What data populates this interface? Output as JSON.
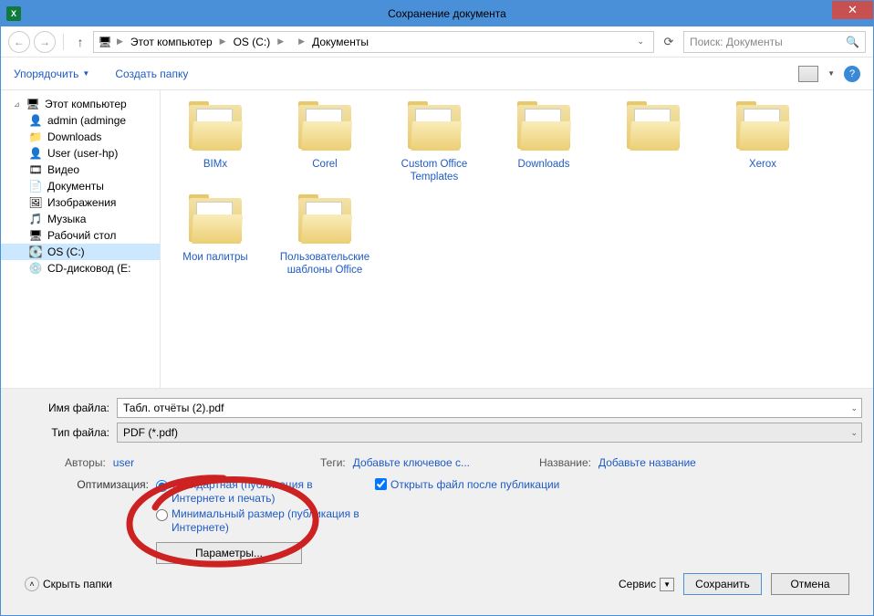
{
  "title": "Сохранение документа",
  "nav": {
    "breadcrumb": [
      "Этот компьютер",
      "OS (C:)",
      "",
      "Документы"
    ],
    "search_placeholder": "Поиск: Документы"
  },
  "toolbar": {
    "organize": "Упорядочить",
    "new_folder": "Создать папку"
  },
  "tree": {
    "root": "Этот компьютер",
    "items": [
      {
        "label": "admin (adminge",
        "icon": "👤"
      },
      {
        "label": "Downloads",
        "icon": "📁"
      },
      {
        "label": "User (user-hp)",
        "icon": "👤"
      },
      {
        "label": "Видео",
        "icon": "🎞"
      },
      {
        "label": "Документы",
        "icon": "📄"
      },
      {
        "label": "Изображения",
        "icon": "🖼"
      },
      {
        "label": "Музыка",
        "icon": "🎵"
      },
      {
        "label": "Рабочий стол",
        "icon": "🖥"
      },
      {
        "label": "OS (C:)",
        "icon": "💽",
        "selected": true
      },
      {
        "label": "CD-дисковод (E:",
        "icon": "💿"
      }
    ]
  },
  "folders": [
    "BIMx",
    "Corel",
    "Custom Office Templates",
    "Downloads",
    "",
    "Xerox",
    "Мои палитры",
    "Пользовательские шаблоны Office"
  ],
  "file": {
    "name_label": "Имя файла:",
    "name_value": "Табл. отчёты (2).pdf",
    "type_label": "Тип файла:",
    "type_value": "PDF (*.pdf)"
  },
  "meta": {
    "authors_label": "Авторы:",
    "authors_value": "user",
    "tags_label": "Теги:",
    "tags_value": "Добавьте ключевое с...",
    "title_label": "Название:",
    "title_value": "Добавьте название"
  },
  "optimize": {
    "label": "Оптимизация:",
    "standard": "Стандартная (публикация в Интернете и печать)",
    "minimum": "Минимальный размер (публикация в Интернете)",
    "open_after": "Открыть файл после публикации",
    "params_btn": "Параметры..."
  },
  "footer": {
    "hide_folders": "Скрыть папки",
    "service": "Сервис",
    "save": "Сохранить",
    "cancel": "Отмена"
  }
}
